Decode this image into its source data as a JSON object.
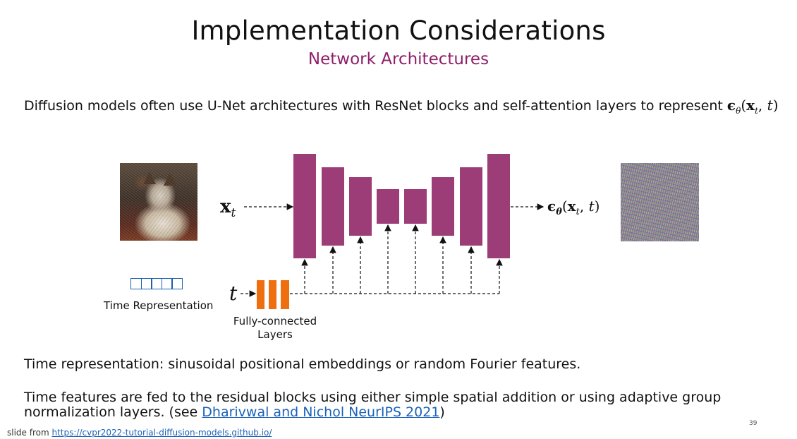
{
  "slide": {
    "title": "Implementation Considerations",
    "subtitle": "Network Architectures",
    "intro_text": "Diffusion models often use U-Net architectures with ResNet blocks and self-attention layers to represent ",
    "intro_math": "ϵθ(xt, t)",
    "paragraph1": "Time representation: sinusoidal positional embeddings or random Fourier features.",
    "paragraph2_text": "Time features are fed to the residual blocks using either simple spatial addition or using adaptive group normalization layers. (see ",
    "paragraph2_link": "Dharivwal and Nichol NeurIPS 2021",
    "paragraph2_end": ")",
    "footer_prefix": "slide from ",
    "footer_link": "https://cvpr2022-tutorial-diffusion-models.github.io/",
    "page_number": "39"
  },
  "diagram": {
    "input_label": "xt",
    "output_label": "ϵθ(xt, t)",
    "time_symbol": "t",
    "time_representation_label": "Time Representation",
    "fc_label_line1": "Fully-connected",
    "fc_label_line2": "Layers",
    "colors": {
      "unet_block": "#9c3d78",
      "fc_layer": "#ef6f10",
      "time_rep_border": "#1f5fae",
      "subtitle": "#8e1f6a",
      "link": "#1b62b8"
    },
    "images": [
      "noisy-cat-image",
      "noise-image"
    ]
  }
}
